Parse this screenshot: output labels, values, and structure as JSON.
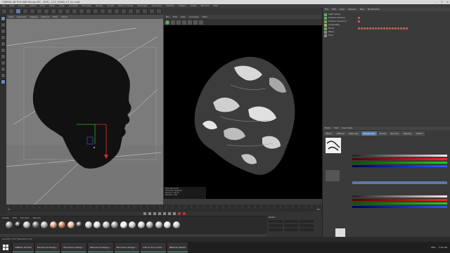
{
  "window": {
    "title": "CINEMA 4D R19.068 Studio (RC - R19) - [3.2_HEAD_V7_01.c4d]",
    "controls": [
      "–",
      "□",
      "✕"
    ]
  },
  "menu": [
    "File",
    "Edit",
    "Create",
    "Select",
    "Tools",
    "Mesh",
    "Snap",
    "Animate",
    "Simulate",
    "Render",
    "Sculpt",
    "Motion Tracker",
    "MoGraph",
    "Character",
    "Pipeline",
    "Plugins",
    "Script",
    "Window",
    "Help"
  ],
  "viewport": {
    "tabs": [
      "View",
      "Cameras",
      "Display",
      "Options",
      "Filter",
      "Panel"
    ]
  },
  "render_view": {
    "tabs": [
      "File",
      "Edit",
      "View",
      "Compare",
      "Filter"
    ],
    "info": [
      "ECS: RW Scene",
      "XD Mode: Disabled",
      "Render: 0:00:12",
      "Samples: 256"
    ]
  },
  "object_manager": {
    "tabs": [
      "File",
      "Edit",
      "View",
      "Objects",
      "Tags",
      "Bookmarks"
    ],
    "objects": [
      {
        "name": "Light Setup",
        "color": "#6a6"
      },
      {
        "name": "Octane Camera",
        "color": "#6a6"
      },
      {
        "name": "Octane Camera.1",
        "color": "#6a6"
      },
      {
        "name": "OctaneSky",
        "color": "#aa6"
      },
      {
        "name": "Head",
        "color": "#6a6"
      },
      {
        "name": "Plane",
        "color": "#888"
      },
      {
        "name": "Floor",
        "color": "#888"
      }
    ]
  },
  "attributes": {
    "tabs": [
      "Mode",
      "Edit",
      "User Data"
    ],
    "sub_tabs": [
      "Basic",
      "Diffuse",
      "Specular",
      "Roughness",
      "Bump",
      "Normal",
      "Opacity",
      "Editor"
    ],
    "active_tab": "Roughness"
  },
  "timeline": {
    "start": "0 F",
    "end": "90 F"
  },
  "materials": {
    "menu": [
      "Create",
      "Edit",
      "Function",
      "Texture"
    ],
    "count": 20
  },
  "coords": {
    "labels": [
      "Position",
      "Size",
      "Rotation"
    ]
  },
  "status": "Azimuth: 0.0°  Elevation: 0.0°",
  "taskbar": {
    "items": [
      "CINEMA 4D R19",
      "Marvelous Design...",
      "Marvelous Design...",
      "Marvelous Design...",
      "Marvelous Design...",
      "C4D R 12.2 Lumin...",
      "BRIDGE_PRO03"
    ],
    "tray": [
      "ENG",
      "5:36 AM"
    ]
  }
}
